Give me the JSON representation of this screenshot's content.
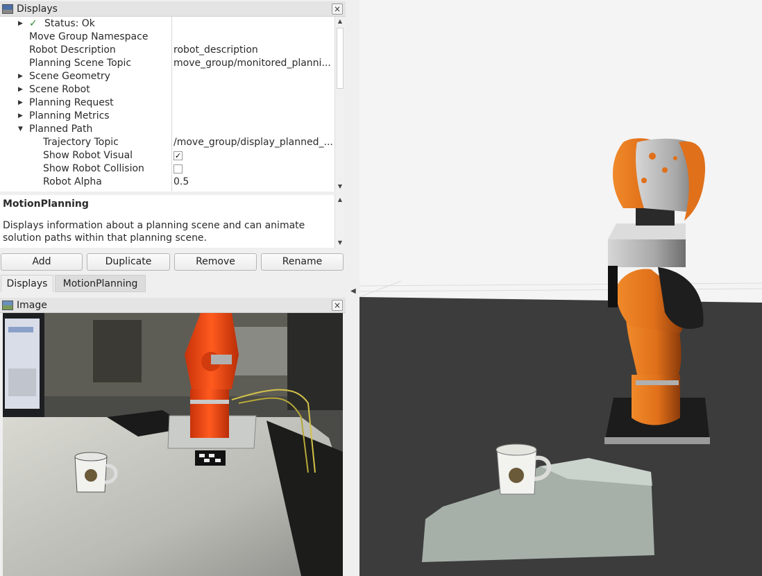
{
  "displays_panel": {
    "title": "Displays",
    "close": "×",
    "tree": [
      {
        "label": "Status: Ok",
        "status_mark": "✓",
        "arrow": "▶",
        "value": ""
      },
      {
        "label": "Move Group Namespace",
        "value": ""
      },
      {
        "label": "Robot Description",
        "value": "robot_description"
      },
      {
        "label": "Planning Scene Topic",
        "value": "move_group/monitored_planni..."
      },
      {
        "label": "Scene Geometry",
        "arrow": "▶",
        "value": ""
      },
      {
        "label": "Scene Robot",
        "arrow": "▶",
        "value": ""
      },
      {
        "label": "Planning Request",
        "arrow": "▶",
        "value": ""
      },
      {
        "label": "Planning Metrics",
        "arrow": "▶",
        "value": ""
      },
      {
        "label": "Planned Path",
        "arrow": "▼",
        "value": ""
      },
      {
        "label": "Trajectory Topic",
        "value": "/move_group/display_planned_..."
      },
      {
        "label": "Show Robot Visual",
        "checked": true,
        "check_mark": "✓"
      },
      {
        "label": "Show Robot Collision",
        "checked": false
      },
      {
        "label": "Robot Alpha",
        "value": "0.5"
      }
    ],
    "description": {
      "title": "MotionPlanning",
      "text": "Displays information about a planning scene and can animate solution paths within that planning scene."
    },
    "buttons": {
      "add": "Add",
      "duplicate": "Duplicate",
      "remove": "Remove",
      "rename": "Rename"
    },
    "tabs": [
      {
        "label": "Displays",
        "active": true
      },
      {
        "label": "MotionPlanning",
        "active": false
      }
    ]
  },
  "image_panel": {
    "title": "Image",
    "close": "×"
  },
  "colors": {
    "robot_orange": "#ff4a12",
    "robot_orange_3d": "#e8741a",
    "robot_grey": "#9a9a9a",
    "floor": "#3b3b3b",
    "sky": "#f2f2f2",
    "status_ok": "#2d8a2d"
  },
  "icons": {
    "displays": "monitor-icon",
    "image": "image-icon",
    "close": "close-icon",
    "expand": "triangle-right-icon",
    "collapse": "triangle-down-icon",
    "scroll_up": "arrow-up-icon",
    "scroll_down": "arrow-down-icon"
  }
}
